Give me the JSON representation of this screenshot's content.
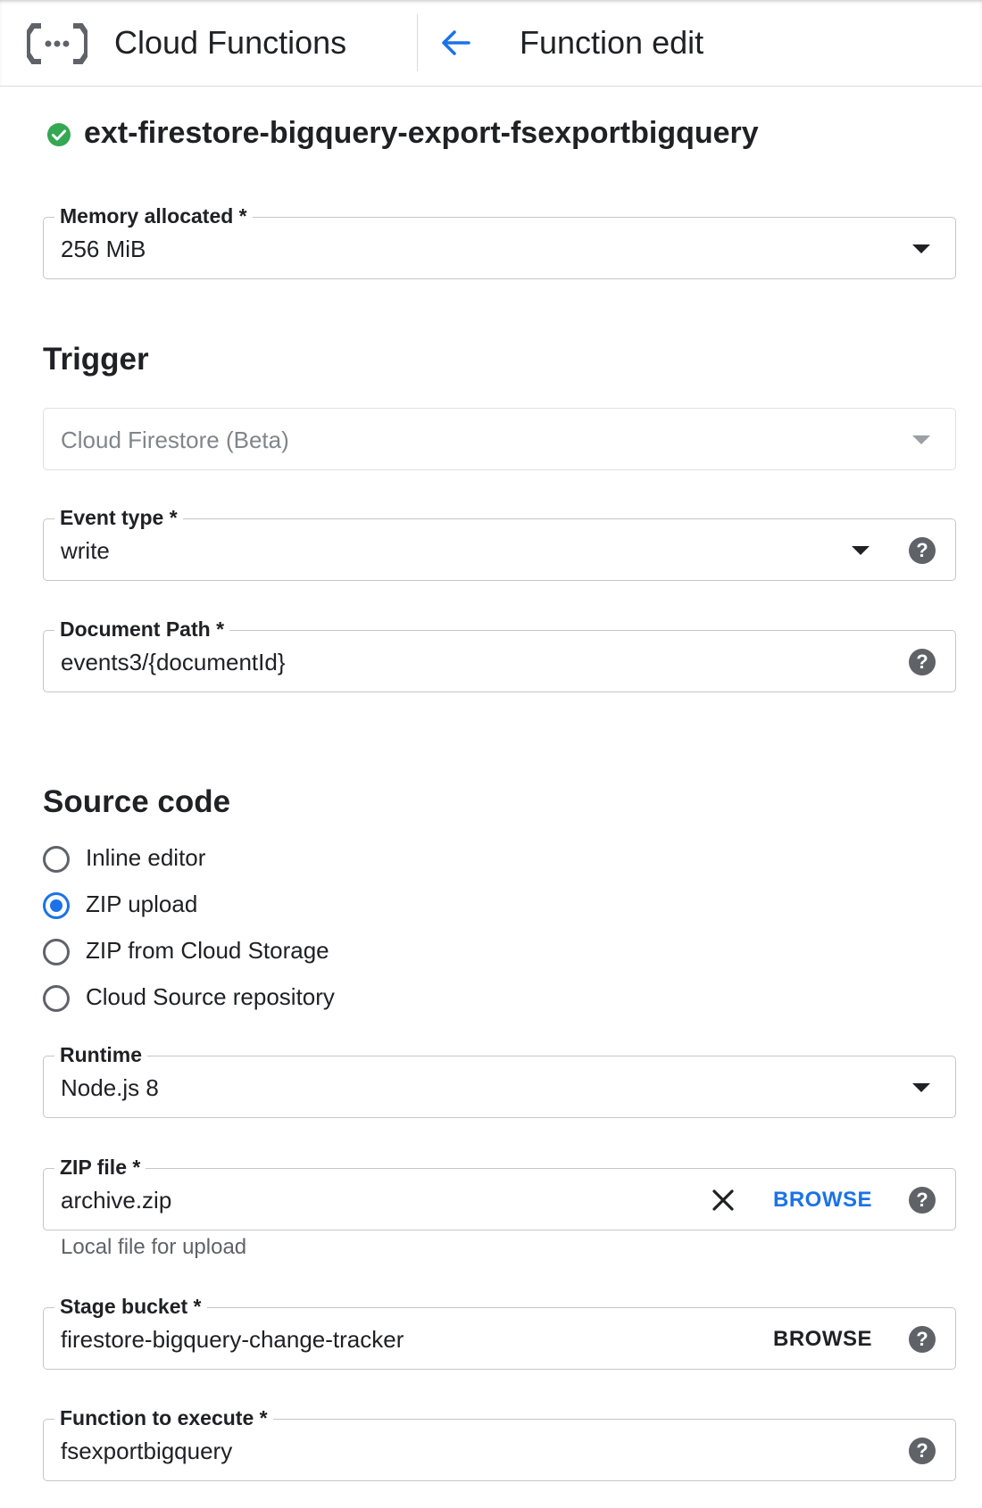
{
  "header": {
    "app_title": "Cloud Functions",
    "page_title": "Function edit"
  },
  "function": {
    "name": "ext-firestore-bigquery-export-fsexportbigquery",
    "status": "deployed"
  },
  "memory": {
    "label": "Memory allocated *",
    "value": "256 MiB"
  },
  "trigger": {
    "title": "Trigger",
    "provider": "Cloud Firestore (Beta)",
    "event_type": {
      "label": "Event type *",
      "value": "write"
    },
    "document_path": {
      "label": "Document Path *",
      "value": "events3/{documentId}"
    }
  },
  "source": {
    "title": "Source code",
    "options": [
      {
        "label": "Inline editor",
        "selected": false
      },
      {
        "label": "ZIP upload",
        "selected": true
      },
      {
        "label": "ZIP from Cloud Storage",
        "selected": false
      },
      {
        "label": "Cloud Source repository",
        "selected": false
      }
    ],
    "runtime": {
      "label": "Runtime",
      "value": "Node.js 8"
    },
    "zip_file": {
      "label": "ZIP file *",
      "value": "archive.zip",
      "browse_label": "BROWSE",
      "helper": "Local file for upload"
    },
    "stage_bucket": {
      "label": "Stage bucket *",
      "value": "firestore-bigquery-change-tracker",
      "browse_label": "BROWSE"
    },
    "function_to_execute": {
      "label": "Function to execute *",
      "value": "fsexportbigquery"
    }
  },
  "help_glyph": "?",
  "colors": {
    "accent": "#1a73e8",
    "success": "#34a853",
    "text": "#202124",
    "muted": "#5f6368",
    "border": "#c6c6c6"
  }
}
